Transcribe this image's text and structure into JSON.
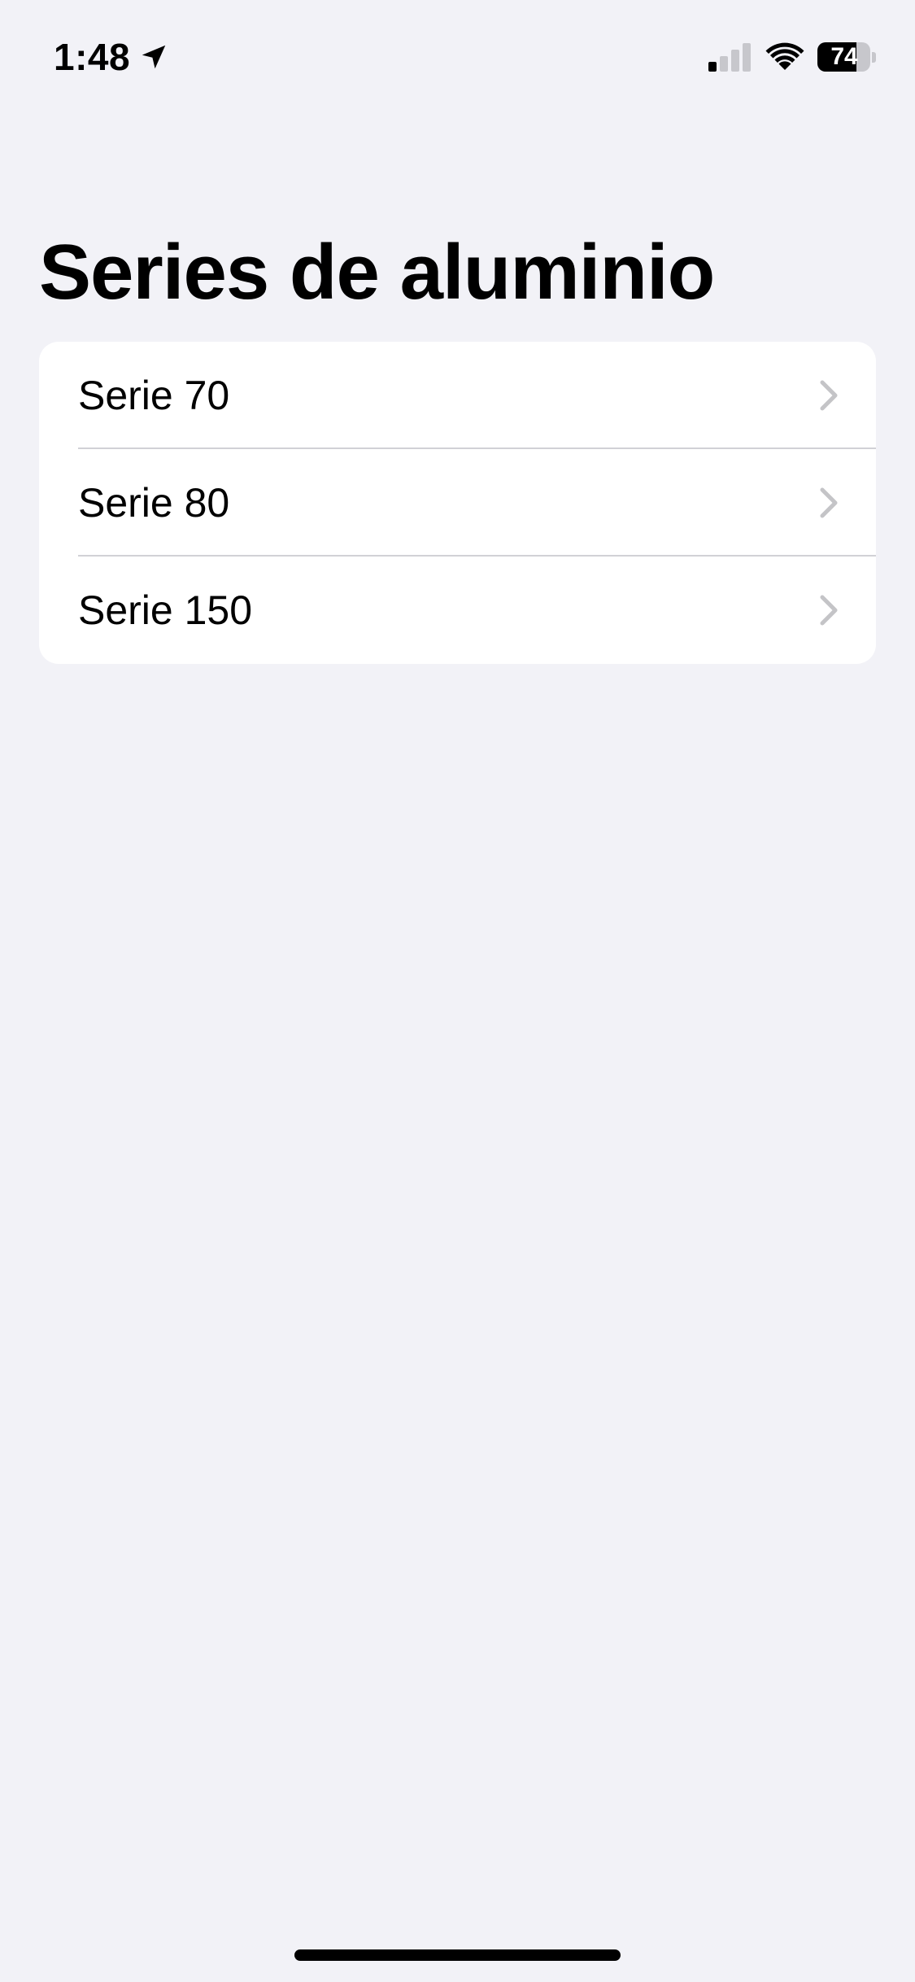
{
  "status_bar": {
    "time": "1:48",
    "location_icon": "location-arrow-icon",
    "signal_icon": "cellular-signal-icon",
    "signal_bars_active": 1,
    "signal_bars_total": 4,
    "wifi_icon": "wifi-icon",
    "battery_percent": "74",
    "battery_level": 0.74
  },
  "page": {
    "title": "Series de aluminio"
  },
  "list": {
    "items": [
      {
        "label": "Serie 70",
        "icon": "chevron-right-icon"
      },
      {
        "label": "Serie 80",
        "icon": "chevron-right-icon"
      },
      {
        "label": "Serie 150",
        "icon": "chevron-right-icon"
      }
    ]
  },
  "colors": {
    "background": "#f2f2f7",
    "card": "#ffffff",
    "separator": "#d1d1d6",
    "chevron": "#c4c4c7",
    "text": "#000000"
  }
}
